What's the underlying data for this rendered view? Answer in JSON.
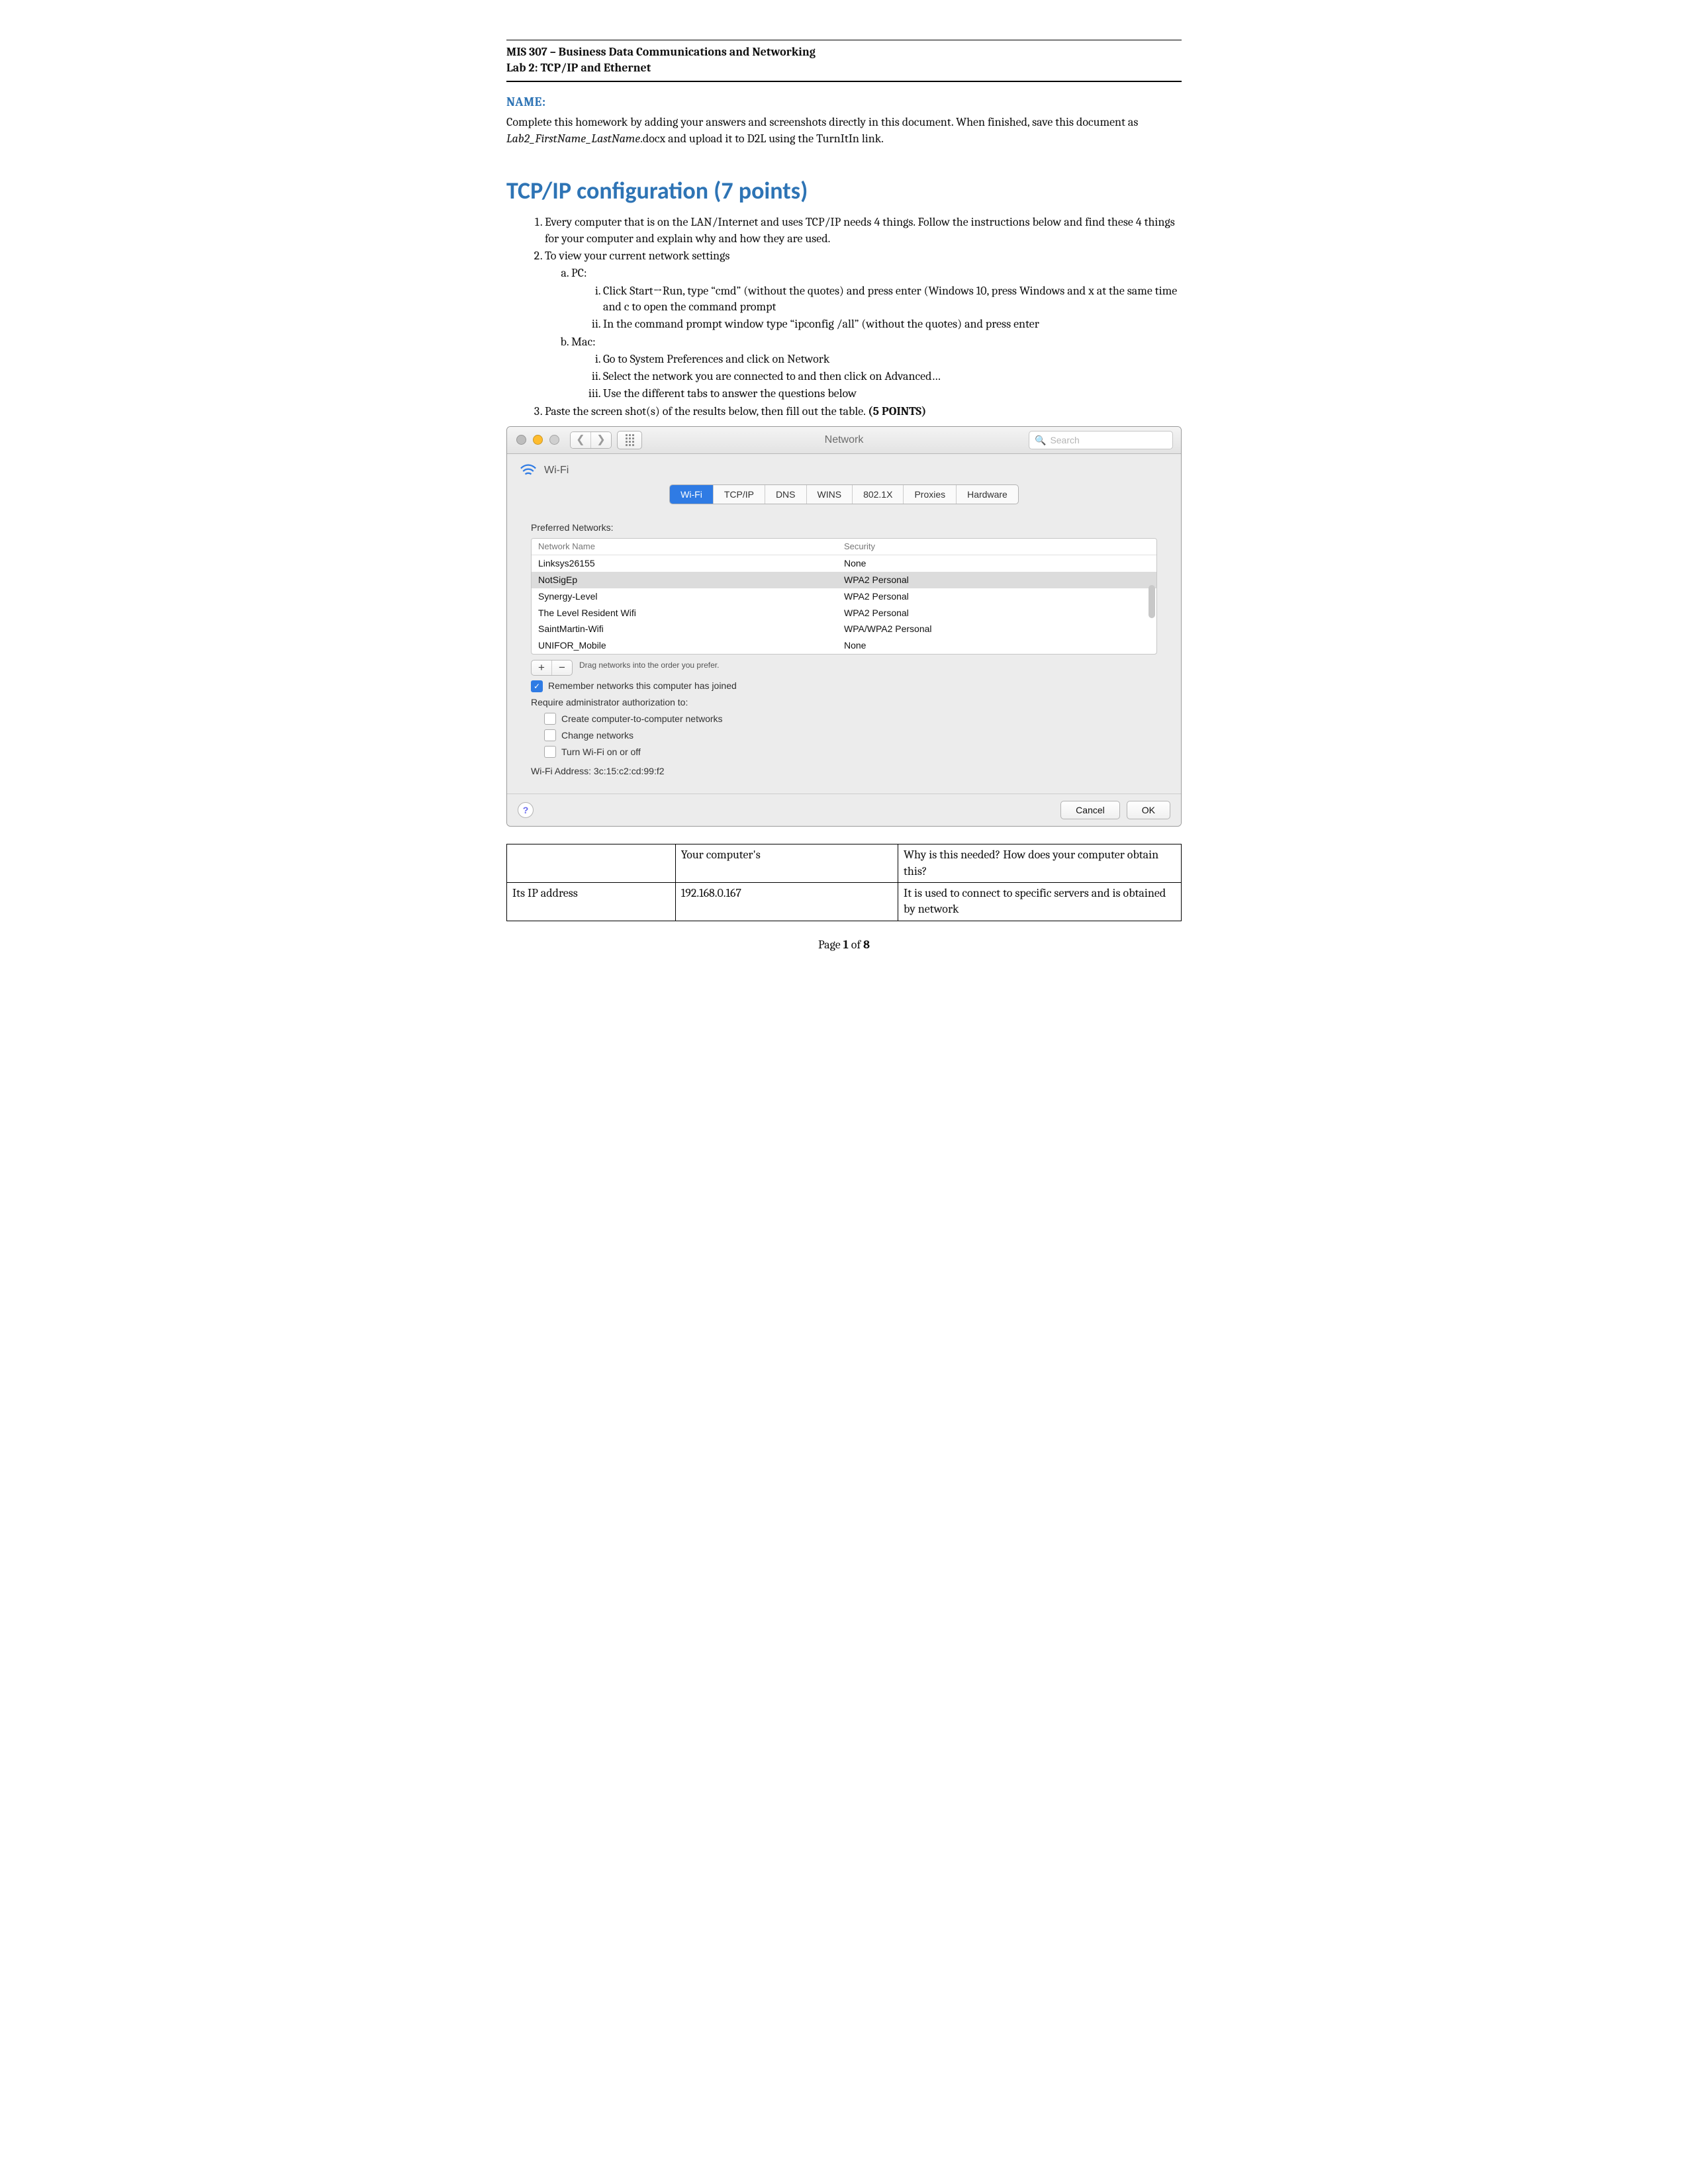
{
  "header": {
    "course": "MIS 307 – Business Data Communications and Networking",
    "lab": "Lab 2: TCP/IP and Ethernet"
  },
  "name_label": "NAME:",
  "instructions_pre": "Complete this homework by adding your answers and screenshots directly in this document. When finished, save this document as ",
  "instructions_filename": "Lab2_FirstName_LastName",
  "instructions_post": ".docx and upload it to D2L using the TurnItIn link.",
  "section_title": "TCP/IP configuration (7 points)",
  "q1": "Every computer that is on the LAN/Internet and uses TCP/IP needs 4 things.  Follow the instructions below and find these 4 things for your computer and explain why and how they are used.",
  "q2": "To view your current network settings",
  "q2a": "PC:",
  "q2a_i": "Click Start→Run, type “cmd” (without the quotes) and press enter (Windows 10, press Windows and x at the same time and c to open the command prompt",
  "q2a_ii": "In the command prompt window type “ipconfig /all” (without the quotes) and press enter",
  "q2b": "Mac:",
  "q2b_i": "Go to System Preferences and click on Network",
  "q2b_ii": "Select the network you are connected to and then click on Advanced…",
  "q2b_iii": "Use the different tabs to answer the questions below",
  "q3_pre": "Paste the screen shot(s) of the results below, then fill out the table.  ",
  "q3_bold": "(5 POINTS)",
  "mac": {
    "title": "Network",
    "search_placeholder": "Search",
    "wifi_label": "Wi-Fi",
    "tabs": [
      "Wi-Fi",
      "TCP/IP",
      "DNS",
      "WINS",
      "802.1X",
      "Proxies",
      "Hardware"
    ],
    "pref_label": "Preferred Networks:",
    "cols": {
      "name": "Network Name",
      "sec": "Security"
    },
    "networks": [
      {
        "name": "Linksys26155",
        "sec": "None",
        "selected": false
      },
      {
        "name": "NotSigEp",
        "sec": "WPA2 Personal",
        "selected": true
      },
      {
        "name": "Synergy-Level",
        "sec": "WPA2 Personal",
        "selected": false
      },
      {
        "name": "The Level Resident Wifi",
        "sec": "WPA2 Personal",
        "selected": false
      },
      {
        "name": "SaintMartin-Wifi",
        "sec": "WPA/WPA2 Personal",
        "selected": false
      },
      {
        "name": "UNIFOR_Mobile",
        "sec": "None",
        "selected": false
      }
    ],
    "drag_hint": "Drag networks into the order you prefer.",
    "remember": "Remember networks this computer has joined",
    "require": "Require administrator authorization to:",
    "opt1": "Create computer-to-computer networks",
    "opt2": "Change networks",
    "opt3": "Turn Wi-Fi on or off",
    "addr_label": "Wi-Fi Address:  ",
    "addr": "3c:15:c2:cd:99:f2",
    "cancel": "Cancel",
    "ok": "OK"
  },
  "table": {
    "h2": "Your computer's",
    "h3": "Why is this needed?  How does your computer obtain this?",
    "r1c1": "Its IP address",
    "r1c2": "192.168.0.167",
    "r1c3": "It is used to connect to specific servers and is obtained by network"
  },
  "footer_pre": "Page ",
  "footer_bold": "1",
  "footer_post": " of ",
  "footer_total": "8"
}
